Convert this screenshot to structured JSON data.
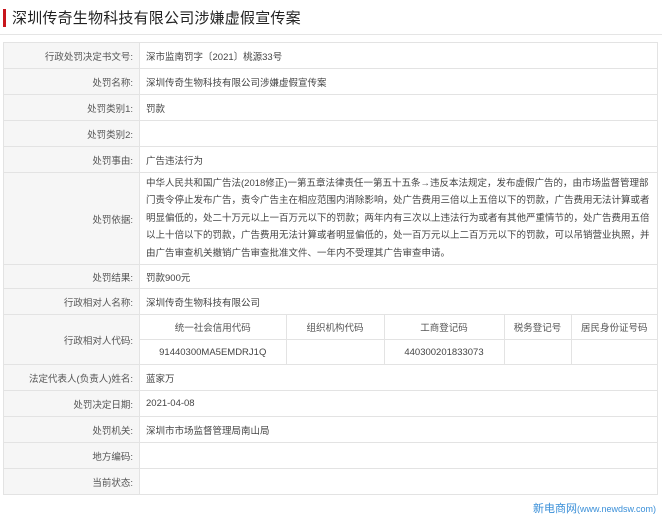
{
  "page": {
    "title": "深圳传奇生物科技有限公司涉嫌虚假宣传案"
  },
  "rows": {
    "doc_no": {
      "label": "行政处罚决定书文号:",
      "value": "深市监南罚字〔2021〕桃源33号"
    },
    "case_name": {
      "label": "处罚名称:",
      "value": "深圳传奇生物科技有限公司涉嫌虚假宣传案"
    },
    "category1": {
      "label": "处罚类别1:",
      "value": "罚款"
    },
    "category2": {
      "label": "处罚类别2:",
      "value": ""
    },
    "reason": {
      "label": "处罚事由:",
      "value": "广告违法行为"
    },
    "basis": {
      "label": "处罚依据:",
      "value": "中华人民共和国广告法(2018修正)一第五章法律责任一第五十五条→违反本法规定，发布虚假广告的，由市场监督管理部门责令停止发布广告，责令广告主在相应范围内消除影响，处广告费用三倍以上五倍以下的罚款，广告费用无法计算或者明显偏低的，处二十万元以上一百万元以下的罚款；两年内有三次以上违法行为或者有其他严重情节的，处广告费用五倍以上十倍以下的罚款，广告费用无法计算或者明显偏低的，处一百万元以上二百万元以下的罚款，可以吊销营业执照，并由广告审查机关撤销广告审查批准文件、一年内不受理其广告审查申请。"
    },
    "result": {
      "label": "处罚结果:",
      "value": "罚款900元"
    },
    "counterparty": {
      "label": "行政相对人名称:",
      "value": "深圳传奇生物科技有限公司"
    },
    "codes": {
      "label": "行政相对人代码:",
      "headers": [
        "统一社会信用代码",
        "组织机构代码",
        "工商登记码",
        "税务登记号",
        "居民身份证号码"
      ],
      "values": [
        "91440300MA5EMDRJ1Q",
        "",
        "440300201833073",
        "",
        ""
      ]
    },
    "legal_rep": {
      "label": "法定代表人(负责人)姓名:",
      "value": "蓝家万"
    },
    "decision_date": {
      "label": "处罚决定日期:",
      "value": "2021-04-08"
    },
    "authority": {
      "label": "处罚机关:",
      "value": "深圳市市场监督管理局南山局"
    },
    "region_code": {
      "label": "地方编码:",
      "value": ""
    },
    "status": {
      "label": "当前状态:",
      "value": ""
    }
  },
  "watermark": {
    "brand": "新电商网",
    "url": "(www.newdsw.com)",
    "color": "#3a8fd8"
  },
  "colors": {
    "accent": "#c8161d",
    "label_bg": "#f6f6f6",
    "border": "#e3e3e3"
  }
}
